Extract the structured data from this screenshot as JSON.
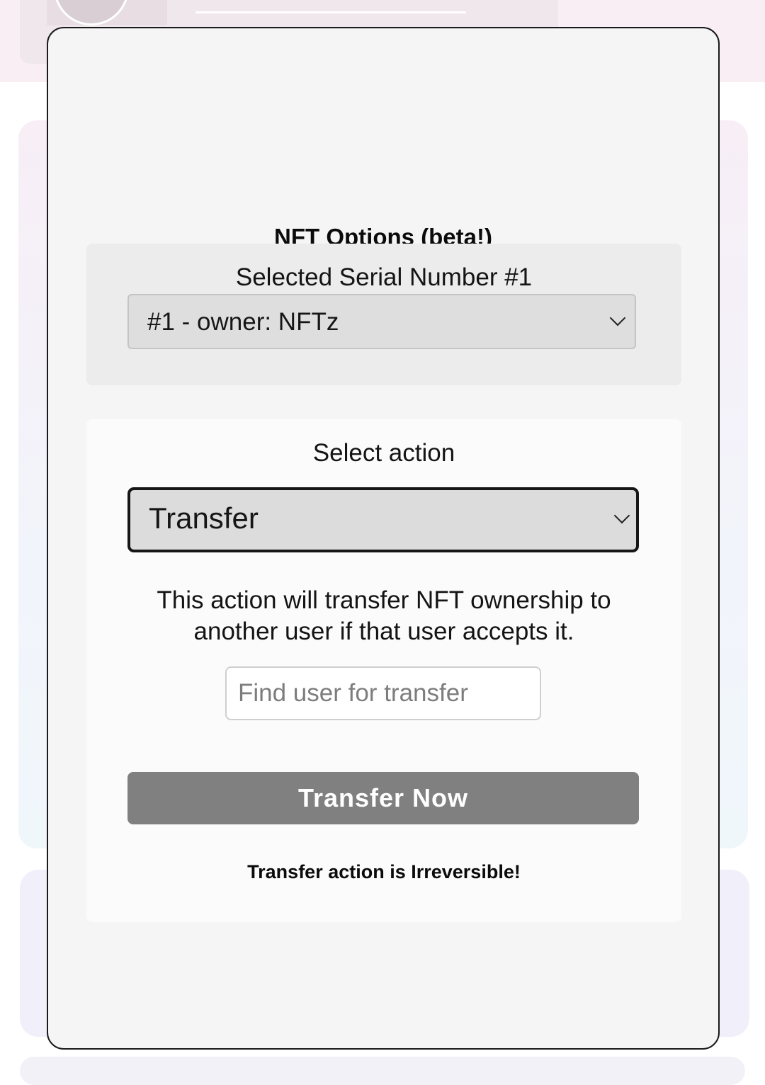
{
  "modal": {
    "title": "NFT Options (beta!)",
    "serial": {
      "label": "Selected Serial Number #1",
      "selected": "#1 - owner: NFTz"
    },
    "action": {
      "label": "Select action",
      "selected": "Transfer",
      "description": "This action will transfer NFT ownership to another user if that user accepts it.",
      "search_placeholder": "Find user for transfer",
      "search_value": "",
      "button_label": "Transfer Now",
      "warning": "Transfer action is Irreversible!"
    }
  },
  "colors": {
    "modal_bg": "#f5f5f5",
    "button_disabled": "#808080",
    "select_bg": "#dcdcdc",
    "backdrop_pink": "#f8eef3"
  },
  "icons": {
    "dropdown": "chevron-down-icon"
  }
}
